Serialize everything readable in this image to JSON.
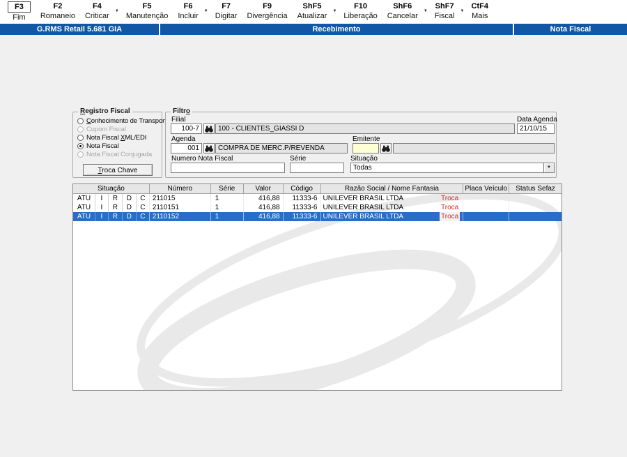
{
  "colors": {
    "titlebar_blue": "#1157A6",
    "selection_blue": "#2B6CC8",
    "troca_red": "#D92B2B"
  },
  "toolbar": {
    "items": [
      {
        "key": "F3",
        "label": "Fim",
        "dropdown": false
      },
      {
        "key": "F2",
        "label": "Romaneio",
        "dropdown": false
      },
      {
        "key": "F4",
        "label": "Criticar",
        "dropdown": true
      },
      {
        "key": "F5",
        "label": "Manutenção",
        "dropdown": false
      },
      {
        "key": "F6",
        "label": "Incluir",
        "dropdown": true
      },
      {
        "key": "F7",
        "label": "Digitar",
        "dropdown": false
      },
      {
        "key": "F9",
        "label": "Divergência",
        "dropdown": false
      },
      {
        "key": "ShF5",
        "label": "Atualizar",
        "dropdown": true
      },
      {
        "key": "F10",
        "label": "Liberação",
        "dropdown": false
      },
      {
        "key": "ShF6",
        "label": "Cancelar",
        "dropdown": true
      },
      {
        "key": "ShF7",
        "label": "Fiscal",
        "dropdown": true
      },
      {
        "key": "CtF4",
        "label": "Mais",
        "dropdown": false
      }
    ]
  },
  "titlebar": {
    "left": "G.RMS Retail 5.681 GIA",
    "center": "Recebimento",
    "right": "Nota Fiscal"
  },
  "registro_fiscal": {
    "title": "Registro Fiscal",
    "options": [
      {
        "label": "Conhecimento de Transporte",
        "selected": false,
        "enabled": true
      },
      {
        "label": "Cupom Fiscal",
        "selected": false,
        "enabled": false
      },
      {
        "label": "Nota Fiscal XML/EDI",
        "selected": false,
        "enabled": true
      },
      {
        "label": "Nota Fiscal",
        "selected": true,
        "enabled": true
      },
      {
        "label": "Nota Fiscal Conjugada",
        "selected": false,
        "enabled": false
      }
    ],
    "button_label": "Troca Chave"
  },
  "filtro": {
    "title": "Filtro",
    "filial_label": "Filial",
    "filial_code": "100-7",
    "filial_name": "100 - CLIENTES_GIASSI D",
    "data_agenda_label": "Data Agenda",
    "data_agenda_value": "21/10/15",
    "agenda_label": "Agenda",
    "agenda_code": "001",
    "agenda_name": "COMPRA DE MERC.P/REVENDA",
    "emitente_label": "Emitente",
    "emitente_code": "",
    "emitente_name": "",
    "numero_label": "Numero Nota Fiscal",
    "numero_value": "",
    "serie_label": "Série",
    "serie_value": "",
    "situacao_label": "Situação",
    "situacao_value": "Todas",
    "lookup_icon": "binoculars-icon"
  },
  "table": {
    "headers": [
      "Situação",
      "Número",
      "Série",
      "Valor",
      "Código",
      "Razão Social / Nome Fantasia",
      "Placa Veículo",
      "Status Sefaz"
    ],
    "rows": [
      {
        "situacao": [
          "ATU",
          "I",
          "R",
          "D",
          "C"
        ],
        "numero": "211015",
        "serie": "1",
        "valor": "416,88",
        "codigo": "11333-6",
        "razao": "UNILEVER BRASIL LTDA",
        "tag": "Troca",
        "placa": "",
        "status": "",
        "selected": false
      },
      {
        "situacao": [
          "ATU",
          "I",
          "R",
          "D",
          "C"
        ],
        "numero": "2110151",
        "serie": "1",
        "valor": "416,88",
        "codigo": "11333-6",
        "razao": "UNILEVER BRASIL LTDA",
        "tag": "Troca",
        "placa": "",
        "status": "",
        "selected": false
      },
      {
        "situacao": [
          "ATU",
          "I",
          "R",
          "D",
          "C"
        ],
        "numero": "2110152",
        "serie": "1",
        "valor": "416,88",
        "codigo": "11333-6",
        "razao": "UNILEVER BRASIL LTDA",
        "tag": "Troca",
        "placa": "",
        "status": "",
        "selected": true
      }
    ]
  }
}
